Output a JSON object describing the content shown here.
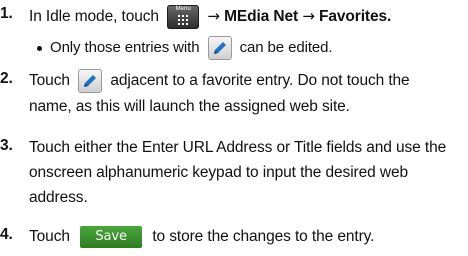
{
  "steps": [
    {
      "number": "1.",
      "before_menu": "In Idle mode, touch",
      "menu_key_label": "Menu",
      "arrow": "→",
      "target": "MEdia Net",
      "arrow2": "→",
      "target2": "Favorites.",
      "bullet_before_icon": "Only those entries with",
      "bullet_after_icon": "can be edited."
    },
    {
      "number": "2.",
      "before_icon": "Touch",
      "after_icon": "adjacent to a favorite entry. Do not touch the",
      "line2": "name, as this will launch the assigned web site."
    },
    {
      "number": "3.",
      "text": "Touch either the Enter URL Address or Title fields and use the onscreen alphanumeric keypad to input the desired web address."
    },
    {
      "number": "4.",
      "before_button": "Touch",
      "button_label": "Save",
      "after_button": "to store the changes to the entry."
    }
  ],
  "colors": {
    "save_button": "#3a9130",
    "pencil_icon": "#1e73c8",
    "menu_key": "#3a3a3a"
  },
  "icons": [
    "menu-key-icon",
    "pencil-edit-icon",
    "save-button"
  ]
}
